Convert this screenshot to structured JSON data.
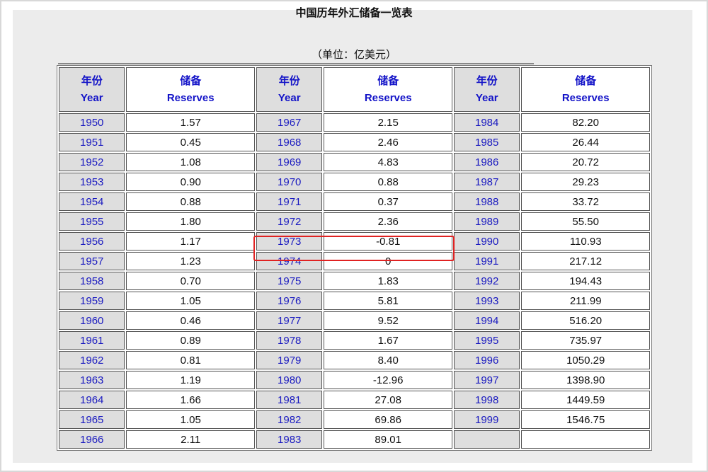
{
  "title": "中国历年外汇储备一览表",
  "unit": "（单位：亿美元）",
  "headers": {
    "year_cn": "年份",
    "year_en": "Year",
    "res_cn": "储备",
    "res_en": "Reserves"
  },
  "rows": [
    [
      [
        "1950",
        "1.57"
      ],
      [
        "1967",
        "2.15"
      ],
      [
        "1984",
        "82.20"
      ]
    ],
    [
      [
        "1951",
        "0.45"
      ],
      [
        "1968",
        "2.46"
      ],
      [
        "1985",
        "26.44"
      ]
    ],
    [
      [
        "1952",
        "1.08"
      ],
      [
        "1969",
        "4.83"
      ],
      [
        "1986",
        "20.72"
      ]
    ],
    [
      [
        "1953",
        "0.90"
      ],
      [
        "1970",
        "0.88"
      ],
      [
        "1987",
        "29.23"
      ]
    ],
    [
      [
        "1954",
        "0.88"
      ],
      [
        "1971",
        "0.37"
      ],
      [
        "1988",
        "33.72"
      ]
    ],
    [
      [
        "1955",
        "1.80"
      ],
      [
        "1972",
        "2.36"
      ],
      [
        "1989",
        "55.50"
      ]
    ],
    [
      [
        "1956",
        "1.17"
      ],
      [
        "1973",
        "-0.81"
      ],
      [
        "1990",
        "110.93"
      ]
    ],
    [
      [
        "1957",
        "1.23"
      ],
      [
        "1974",
        "0"
      ],
      [
        "1991",
        "217.12"
      ]
    ],
    [
      [
        "1958",
        "0.70"
      ],
      [
        "1975",
        "1.83"
      ],
      [
        "1992",
        "194.43"
      ]
    ],
    [
      [
        "1959",
        "1.05"
      ],
      [
        "1976",
        "5.81"
      ],
      [
        "1993",
        "211.99"
      ]
    ],
    [
      [
        "1960",
        "0.46"
      ],
      [
        "1977",
        "9.52"
      ],
      [
        "1994",
        "516.20"
      ]
    ],
    [
      [
        "1961",
        "0.89"
      ],
      [
        "1978",
        "1.67"
      ],
      [
        "1995",
        "735.97"
      ]
    ],
    [
      [
        "1962",
        "0.81"
      ],
      [
        "1979",
        "8.40"
      ],
      [
        "1996",
        "1050.29"
      ]
    ],
    [
      [
        "1963",
        "1.19"
      ],
      [
        "1980",
        "-12.96"
      ],
      [
        "1997",
        "1398.90"
      ]
    ],
    [
      [
        "1964",
        "1.66"
      ],
      [
        "1981",
        "27.08"
      ],
      [
        "1998",
        "1449.59"
      ]
    ],
    [
      [
        "1965",
        "1.05"
      ],
      [
        "1982",
        "69.86"
      ],
      [
        "1999",
        "1546.75"
      ]
    ],
    [
      [
        "1966",
        "2.11"
      ],
      [
        "1983",
        "89.01"
      ],
      [
        "",
        ""
      ]
    ]
  ],
  "highlight_color": "#e02222",
  "year_link_color": "#1a1ac0"
}
